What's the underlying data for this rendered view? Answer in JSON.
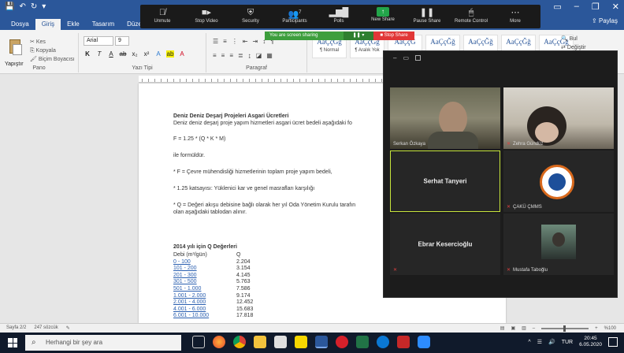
{
  "word": {
    "tabs": [
      "Dosya",
      "Giriş",
      "Ekle",
      "Tasarım",
      "Düzen"
    ],
    "active_tab": 1,
    "share_label": "Paylaş",
    "ribbon": {
      "paste_label": "Yapıştır",
      "clipboard_items": [
        "Kes",
        "Kopyala",
        "Biçim Boyacısı"
      ],
      "clipboard_group": "Pano",
      "font_name": "Arial",
      "font_size": "9",
      "font_group": "Yazı Tipi",
      "paragraph_group": "Paragraf",
      "styles": [
        {
          "sample": "AaÇçĞğ",
          "label": "¶ Normal"
        },
        {
          "sample": "AaÇçĞğ",
          "label": "¶ Aralık Yok"
        },
        {
          "sample": "AaÇçĞ",
          "label": ""
        },
        {
          "sample": "AaÇçĞğ",
          "label": ""
        },
        {
          "sample": "AaÇçĞğ",
          "label": ""
        },
        {
          "sample": "AaÇçĞğ",
          "label": ""
        },
        {
          "sample": "AaÇçĞğ",
          "label": ""
        }
      ],
      "editing_items": [
        "Bul",
        "Değiştir"
      ]
    },
    "document": {
      "heading": "Deniz Deniz Deşarj Projeleri Asgari Ücretleri",
      "intro": "Deniz deniz deşarj proje yapım hizmetleri asgari ücret bedeli aşağıdaki fo",
      "formula": "F = 1.25 * (Q * K * M)",
      "formula_note": "ile formüldür.",
      "bullet1": "* F = Çevre mühendisliği hizmetlerinin toplam proje yapım bedeli,",
      "bullet2": "* 1.25 katsayısı: Yüklenici kar ve genel masrafları karşılığı",
      "bullet3a": "* Q = Değeri akışu debisine bağlı olarak her yıl Oda Yönetim Kurulu tarafın",
      "bullet3b": "olan aşağıdaki tablodan alınır.",
      "table_title": "2014 yılı için Q Değerleri",
      "table_headers": [
        "Debi (m³/gün)",
        "Q"
      ],
      "table_rows": [
        [
          "0 - 100",
          "2.204"
        ],
        [
          "101 - 200",
          "3.154"
        ],
        [
          "201 - 300",
          "4.145"
        ],
        [
          "301 - 500",
          "5.763"
        ],
        [
          "501 - 1.000",
          "7.586"
        ],
        [
          "1.001 - 2.000",
          "9.174"
        ],
        [
          "2.001 - 4.000",
          "12.452"
        ],
        [
          "4.001 - 6.000",
          "15.683"
        ],
        [
          "6.001 - 10.000",
          "17.818"
        ]
      ]
    },
    "status_bar": {
      "page": "Sayfa 2/2",
      "words": "247 sözcük",
      "zoom": "%100"
    }
  },
  "zoom": {
    "toolbar": [
      {
        "label": "Unmute",
        "icon": "mic-off-icon"
      },
      {
        "label": "Stop Video",
        "icon": "video-icon"
      },
      {
        "label": "Security",
        "icon": "shield-icon"
      },
      {
        "label": "Participants",
        "icon": "participants-icon",
        "count": "7"
      },
      {
        "label": "Polls",
        "icon": "polls-icon"
      },
      {
        "label": "New Share",
        "icon": "new-share-icon"
      },
      {
        "label": "Pause Share",
        "icon": "pause-icon"
      },
      {
        "label": "Remote Control",
        "icon": "remote-control-icon"
      },
      {
        "label": "More",
        "icon": "more-icon"
      }
    ],
    "share_notice": "You are screen sharing",
    "stop_share": "■ Stop Share",
    "participants": [
      {
        "name": "Serkan Özkaya",
        "type": "video"
      },
      {
        "name": "Zehra Gündüz",
        "type": "video"
      },
      {
        "name": "Serhat Tanyeri",
        "type": "name",
        "active": true
      },
      {
        "name": "ÇAKÜ ÇMMS",
        "type": "logo"
      },
      {
        "name": "Ebrar Kesercioğlu",
        "type": "name"
      },
      {
        "name": "Mustafa Taboğlu",
        "type": "photo"
      }
    ]
  },
  "taskbar": {
    "search_placeholder": "Herhangi bir şey ara",
    "time": "20:45",
    "date": "6.05.2020",
    "language": "TUR"
  },
  "colors": {
    "word_blue": "#2b579a",
    "zoom_green": "#23a54a",
    "stop_red": "#e13737",
    "taskbar": "#101a2b"
  }
}
